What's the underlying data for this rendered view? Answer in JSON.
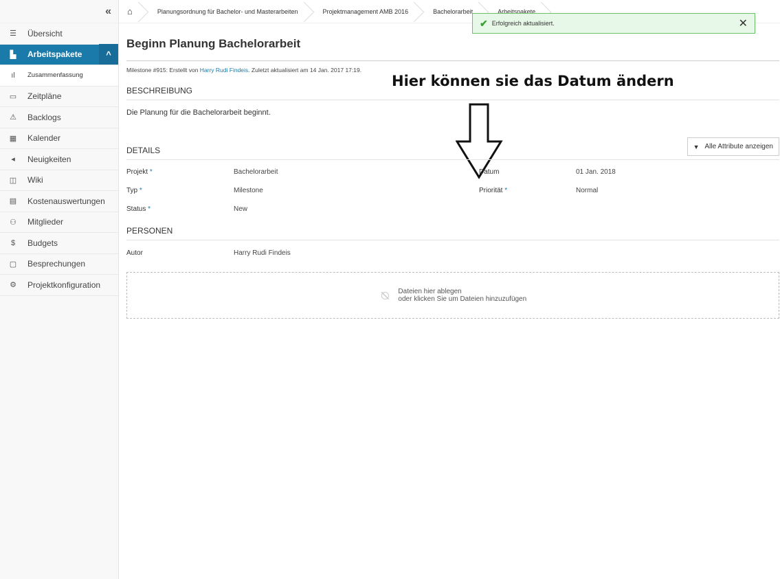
{
  "sidebar": {
    "collapse_icon": "«",
    "items": [
      {
        "label": "Übersicht",
        "icon": "☰"
      },
      {
        "label": "Arbeitspakete",
        "icon": "▙",
        "chevron": "^"
      },
      {
        "label": "Zusammenfassung",
        "icon": "ıl"
      },
      {
        "label": "Zeitpläne",
        "icon": "▭"
      },
      {
        "label": "Backlogs",
        "icon": "⚠"
      },
      {
        "label": "Kalender",
        "icon": "▦"
      },
      {
        "label": "Neuigkeiten",
        "icon": "◂"
      },
      {
        "label": "Wiki",
        "icon": "◫"
      },
      {
        "label": "Kostenauswertungen",
        "icon": "▤"
      },
      {
        "label": "Mitglieder",
        "icon": "⚇"
      },
      {
        "label": "Budgets",
        "icon": "$"
      },
      {
        "label": "Besprechungen",
        "icon": "▢"
      },
      {
        "label": "Projektkonfiguration",
        "icon": "⚙"
      }
    ]
  },
  "breadcrumb": {
    "home_icon": "⌂",
    "items": [
      "Planungsordnung für Bachelor- und Masterarbeiten",
      "Projektmanagement AMB 2016",
      "Bachelorarbeit",
      "Arbeitspakete"
    ]
  },
  "toast": {
    "message": "Erfolgreich aktualisiert.",
    "check": "✔",
    "close": "✕"
  },
  "workpackage": {
    "title": "Beginn Planung Bachelorarbeit",
    "meta_prefix": "Milestone #915: Erstellt von ",
    "meta_author": "Harry Rudi Findeis",
    "meta_suffix": ". Zuletzt aktualisiert am 14 Jan. 2017 17:19."
  },
  "annotation": "Hier können sie das Datum ändern",
  "description": {
    "heading": "BESCHREIBUNG",
    "text": "Die Planung für die Bachelorarbeit beginnt."
  },
  "details": {
    "heading": "DETAILS",
    "show_all_label": "Alle Attribute anzeigen",
    "projekt_label": "Projekt",
    "projekt_value": "Bachelorarbeit",
    "typ_label": "Typ",
    "typ_value": "Milestone",
    "status_label": "Status",
    "status_value": "New",
    "datum_label": "Datum",
    "datum_value": "01 Jan. 2018",
    "prioritaet_label": "Priorität",
    "prioritaet_value": "Normal",
    "required_mark": "*"
  },
  "persons": {
    "heading": "PERSONEN",
    "autor_label": "Autor",
    "autor_value": "Harry Rudi Findeis"
  },
  "attachments": {
    "line1": "Dateien hier ablegen",
    "line2": "oder klicken Sie um Dateien hinzuzufügen"
  }
}
